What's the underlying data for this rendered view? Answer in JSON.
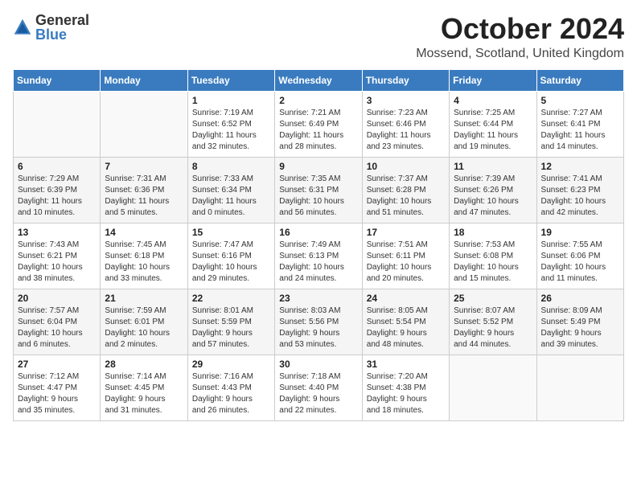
{
  "logo": {
    "general": "General",
    "blue": "Blue"
  },
  "title": {
    "month": "October 2024",
    "location": "Mossend, Scotland, United Kingdom"
  },
  "headers": [
    "Sunday",
    "Monday",
    "Tuesday",
    "Wednesday",
    "Thursday",
    "Friday",
    "Saturday"
  ],
  "rows": [
    [
      {
        "day": "",
        "detail": ""
      },
      {
        "day": "",
        "detail": ""
      },
      {
        "day": "1",
        "detail": "Sunrise: 7:19 AM\nSunset: 6:52 PM\nDaylight: 11 hours\nand 32 minutes."
      },
      {
        "day": "2",
        "detail": "Sunrise: 7:21 AM\nSunset: 6:49 PM\nDaylight: 11 hours\nand 28 minutes."
      },
      {
        "day": "3",
        "detail": "Sunrise: 7:23 AM\nSunset: 6:46 PM\nDaylight: 11 hours\nand 23 minutes."
      },
      {
        "day": "4",
        "detail": "Sunrise: 7:25 AM\nSunset: 6:44 PM\nDaylight: 11 hours\nand 19 minutes."
      },
      {
        "day": "5",
        "detail": "Sunrise: 7:27 AM\nSunset: 6:41 PM\nDaylight: 11 hours\nand 14 minutes."
      }
    ],
    [
      {
        "day": "6",
        "detail": "Sunrise: 7:29 AM\nSunset: 6:39 PM\nDaylight: 11 hours\nand 10 minutes."
      },
      {
        "day": "7",
        "detail": "Sunrise: 7:31 AM\nSunset: 6:36 PM\nDaylight: 11 hours\nand 5 minutes."
      },
      {
        "day": "8",
        "detail": "Sunrise: 7:33 AM\nSunset: 6:34 PM\nDaylight: 11 hours\nand 0 minutes."
      },
      {
        "day": "9",
        "detail": "Sunrise: 7:35 AM\nSunset: 6:31 PM\nDaylight: 10 hours\nand 56 minutes."
      },
      {
        "day": "10",
        "detail": "Sunrise: 7:37 AM\nSunset: 6:28 PM\nDaylight: 10 hours\nand 51 minutes."
      },
      {
        "day": "11",
        "detail": "Sunrise: 7:39 AM\nSunset: 6:26 PM\nDaylight: 10 hours\nand 47 minutes."
      },
      {
        "day": "12",
        "detail": "Sunrise: 7:41 AM\nSunset: 6:23 PM\nDaylight: 10 hours\nand 42 minutes."
      }
    ],
    [
      {
        "day": "13",
        "detail": "Sunrise: 7:43 AM\nSunset: 6:21 PM\nDaylight: 10 hours\nand 38 minutes."
      },
      {
        "day": "14",
        "detail": "Sunrise: 7:45 AM\nSunset: 6:18 PM\nDaylight: 10 hours\nand 33 minutes."
      },
      {
        "day": "15",
        "detail": "Sunrise: 7:47 AM\nSunset: 6:16 PM\nDaylight: 10 hours\nand 29 minutes."
      },
      {
        "day": "16",
        "detail": "Sunrise: 7:49 AM\nSunset: 6:13 PM\nDaylight: 10 hours\nand 24 minutes."
      },
      {
        "day": "17",
        "detail": "Sunrise: 7:51 AM\nSunset: 6:11 PM\nDaylight: 10 hours\nand 20 minutes."
      },
      {
        "day": "18",
        "detail": "Sunrise: 7:53 AM\nSunset: 6:08 PM\nDaylight: 10 hours\nand 15 minutes."
      },
      {
        "day": "19",
        "detail": "Sunrise: 7:55 AM\nSunset: 6:06 PM\nDaylight: 10 hours\nand 11 minutes."
      }
    ],
    [
      {
        "day": "20",
        "detail": "Sunrise: 7:57 AM\nSunset: 6:04 PM\nDaylight: 10 hours\nand 6 minutes."
      },
      {
        "day": "21",
        "detail": "Sunrise: 7:59 AM\nSunset: 6:01 PM\nDaylight: 10 hours\nand 2 minutes."
      },
      {
        "day": "22",
        "detail": "Sunrise: 8:01 AM\nSunset: 5:59 PM\nDaylight: 9 hours\nand 57 minutes."
      },
      {
        "day": "23",
        "detail": "Sunrise: 8:03 AM\nSunset: 5:56 PM\nDaylight: 9 hours\nand 53 minutes."
      },
      {
        "day": "24",
        "detail": "Sunrise: 8:05 AM\nSunset: 5:54 PM\nDaylight: 9 hours\nand 48 minutes."
      },
      {
        "day": "25",
        "detail": "Sunrise: 8:07 AM\nSunset: 5:52 PM\nDaylight: 9 hours\nand 44 minutes."
      },
      {
        "day": "26",
        "detail": "Sunrise: 8:09 AM\nSunset: 5:49 PM\nDaylight: 9 hours\nand 39 minutes."
      }
    ],
    [
      {
        "day": "27",
        "detail": "Sunrise: 7:12 AM\nSunset: 4:47 PM\nDaylight: 9 hours\nand 35 minutes."
      },
      {
        "day": "28",
        "detail": "Sunrise: 7:14 AM\nSunset: 4:45 PM\nDaylight: 9 hours\nand 31 minutes."
      },
      {
        "day": "29",
        "detail": "Sunrise: 7:16 AM\nSunset: 4:43 PM\nDaylight: 9 hours\nand 26 minutes."
      },
      {
        "day": "30",
        "detail": "Sunrise: 7:18 AM\nSunset: 4:40 PM\nDaylight: 9 hours\nand 22 minutes."
      },
      {
        "day": "31",
        "detail": "Sunrise: 7:20 AM\nSunset: 4:38 PM\nDaylight: 9 hours\nand 18 minutes."
      },
      {
        "day": "",
        "detail": ""
      },
      {
        "day": "",
        "detail": ""
      }
    ]
  ]
}
